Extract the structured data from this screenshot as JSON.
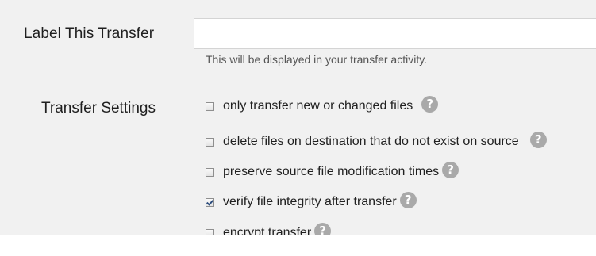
{
  "label_section": {
    "title": "Label This Transfer",
    "input_value": "",
    "helper_text": "This will be displayed in your transfer activity."
  },
  "settings_section": {
    "title": "Transfer Settings",
    "options": [
      {
        "label": "only transfer new or changed files",
        "checked": false,
        "help_icon": "question-circle-icon"
      },
      {
        "label": "delete files on destination that do not exist on source",
        "checked": false,
        "help_icon": "question-circle-icon"
      },
      {
        "label": "preserve source file modification times",
        "checked": false,
        "help_icon": "question-circle-icon"
      },
      {
        "label": "verify file integrity after transfer",
        "checked": true,
        "help_icon": "question-circle-icon"
      },
      {
        "label": "encrypt transfer",
        "checked": false,
        "help_icon": "question-circle-icon"
      }
    ]
  },
  "help_glyph": "?",
  "colors": {
    "panel_background": "#f1f1f1",
    "help_icon": "#a9a9a9",
    "text": "#202020"
  }
}
